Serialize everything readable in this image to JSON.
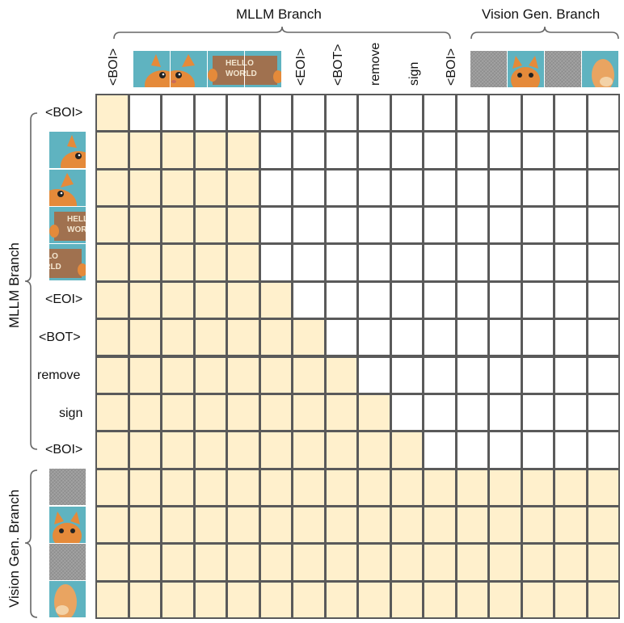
{
  "groups": {
    "mllm_top": "MLLM Branch",
    "vision_top": "Vision Gen. Branch",
    "mllm_side": "MLLM Branch",
    "vision_side": "Vision Gen. Branch"
  },
  "column_tokens": {
    "boi1": "<BOI>",
    "eoi": "<EOI>",
    "bot": "<BOT>",
    "remove": "remove",
    "sign": "sign",
    "boi2": "<BOI>"
  },
  "row_tokens": {
    "boi1": "<BOI>",
    "eoi": "<EOI>",
    "bot": "<BOT>",
    "remove": "remove",
    "sign": "sign",
    "boi2": "<BOI>"
  },
  "sign_text": {
    "line1": "HELLO",
    "line2": "WORLD"
  },
  "mask_rows": [
    "1000000000000000",
    "1111100000000000",
    "1111100000000000",
    "1111100000000000",
    "1111100000000000",
    "1111110000000000",
    "1111111000000000",
    "1111111100000000",
    "1111111110000000",
    "1111111111000000",
    "1111111111111111",
    "1111111111111111",
    "1111111111111111",
    "1111111111111111"
  ],
  "colors": {
    "filled": "#fff0cc",
    "empty": "#ffffff",
    "grid": "#5a5a5a",
    "bracket": "#666666"
  }
}
